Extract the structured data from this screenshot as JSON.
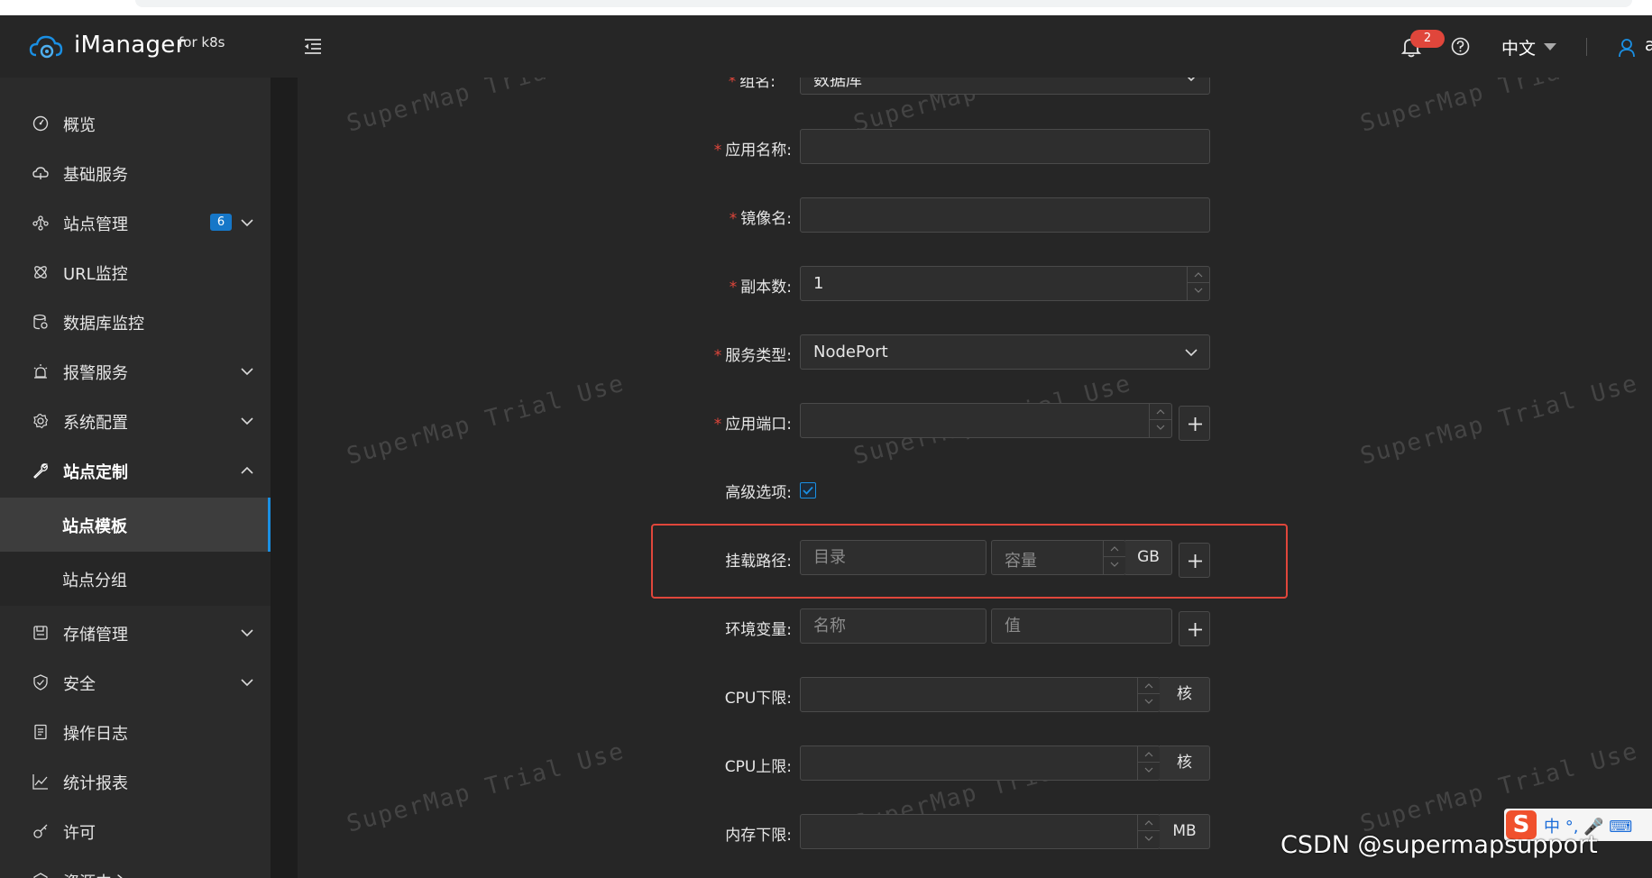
{
  "header": {
    "brand": "iManager",
    "brand_sub": "for k8s",
    "notification_count": "2",
    "language": "中文",
    "user_initial": "a"
  },
  "sidebar": {
    "items": [
      {
        "label": "概览",
        "icon": "dashboard-icon"
      },
      {
        "label": "基础服务",
        "icon": "cloud-service-icon"
      },
      {
        "label": "站点管理",
        "icon": "site-network-icon",
        "badge": "6"
      },
      {
        "label": "URL监控",
        "icon": "url-monitor-icon"
      },
      {
        "label": "数据库监控",
        "icon": "database-monitor-icon"
      },
      {
        "label": "报警服务",
        "icon": "alarm-icon"
      },
      {
        "label": "系统配置",
        "icon": "gear-icon"
      },
      {
        "label": "站点定制",
        "icon": "wrench-icon"
      },
      {
        "label": "存储管理",
        "icon": "storage-icon"
      },
      {
        "label": "安全",
        "icon": "shield-icon"
      },
      {
        "label": "操作日志",
        "icon": "log-icon"
      },
      {
        "label": "统计报表",
        "icon": "chart-icon"
      },
      {
        "label": "许可",
        "icon": "key-icon"
      },
      {
        "label": "资源中心",
        "icon": "resource-icon"
      }
    ],
    "sub_items": [
      {
        "label": "站点模板"
      },
      {
        "label": "站点分组"
      }
    ]
  },
  "form": {
    "group": {
      "label": "组名:",
      "value": "数据库"
    },
    "app_name": {
      "label": "应用名称:",
      "value": ""
    },
    "image_name": {
      "label": "镜像名:",
      "value": ""
    },
    "replicas": {
      "label": "副本数:",
      "value": "1"
    },
    "service_type": {
      "label": "服务类型:",
      "value": "NodePort"
    },
    "app_port": {
      "label": "应用端口:",
      "value": ""
    },
    "advanced": {
      "label": "高级选项:",
      "checked": true
    },
    "mount_path": {
      "label": "挂载路径:",
      "dir_placeholder": "目录",
      "capacity_placeholder": "容量",
      "unit": "GB"
    },
    "env": {
      "label": "环境变量:",
      "name_placeholder": "名称",
      "value_placeholder": "值"
    },
    "cpu_min": {
      "label": "CPU下限:",
      "unit": "核"
    },
    "cpu_max": {
      "label": "CPU上限:",
      "unit": "核"
    },
    "mem_min": {
      "label": "内存下限:",
      "unit": "MB"
    }
  },
  "watermark": "SuperMap Trial Use",
  "overlay": {
    "csdn": "CSDN @supermapsupport",
    "ime_logo": "S",
    "ime_text": "中 °, 🎤 ⌨"
  },
  "colors": {
    "accent": "#1a8fe3",
    "danger": "#e0463b",
    "badge": "#1677c8"
  }
}
